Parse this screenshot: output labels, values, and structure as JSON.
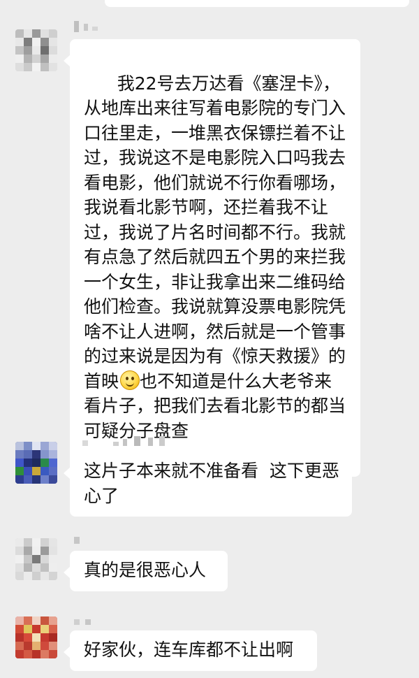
{
  "chat": {
    "messages": [
      {
        "text": "我22号去万达看《塞涅卡》，从地库出来往写着电影院的专门入口往里走，一堆黑衣保镖拦着不让过，我说这不是电影院入口吗我去看电影，他们就说不行你看哪场，我说看北影节啊，还拦着我不让过，我说了片名时间都不行。我就有点急了然后就四五个男的来拦我一个女生，非让我拿出来二维码给他们检查。我说就算没票电影院凭啥不让人进啊，然后就是一个管事的过来说是因为有《惊天救援》的首映",
        "text_after_emoji": "也不知道是什么大老爷来看片子，把我们去看北影节的都当可疑分子盘查",
        "emoji": "smile-emoji"
      },
      {
        "text": "这片子本来就不准备看  这下更恶心了"
      },
      {
        "text": "真的是很恶心人"
      },
      {
        "text": "好家伙，连车库都不让出啊"
      }
    ]
  },
  "colors": {
    "background": "#ededed",
    "bubble": "#ffffff",
    "text": "#111111",
    "blur_name": "#c9c9c9"
  }
}
